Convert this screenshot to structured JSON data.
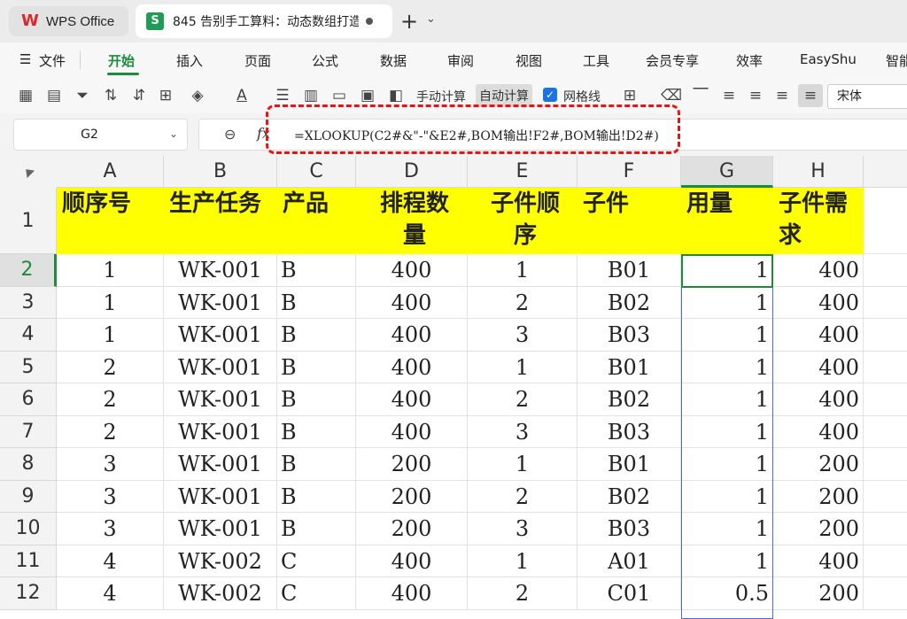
{
  "titlebar": {
    "app_tab": "WPS Office",
    "doc_tab": "845 告别手工算料：动态数组打造",
    "sheet_icon": "S"
  },
  "menu": {
    "file": "文件",
    "items": [
      "开始",
      "插入",
      "页面",
      "公式",
      "数据",
      "审阅",
      "视图",
      "工具",
      "会员专享",
      "效率",
      "EasyShu",
      "智能"
    ]
  },
  "toolbar": {
    "manual_calc": "手动计算",
    "auto_calc": "自动计算",
    "gridlines": "网格线",
    "font": "宋体"
  },
  "formula_bar": {
    "cell_ref": "G2",
    "fx": "fx",
    "formula": "=XLOOKUP(C2#&\"-\"&E2#,BOM输出!F2#,BOM输出!D2#)"
  },
  "sheet": {
    "columns": [
      "A",
      "B",
      "C",
      "D",
      "E",
      "F",
      "G",
      "H"
    ],
    "row_numbers": [
      "1",
      "2",
      "3",
      "4",
      "5",
      "6",
      "7",
      "8",
      "9",
      "10",
      "11",
      "12"
    ],
    "headers": [
      [
        "顺序号"
      ],
      [
        "生产任务"
      ],
      [
        "产品"
      ],
      [
        "排程数",
        "量"
      ],
      [
        "子件顺",
        "序"
      ],
      [
        "子件"
      ],
      [
        "用量"
      ],
      [
        "子件需",
        "求"
      ]
    ],
    "rows": [
      [
        "1",
        "WK-001",
        "B",
        "400",
        "1",
        "B01",
        "1",
        "400"
      ],
      [
        "1",
        "WK-001",
        "B",
        "400",
        "2",
        "B02",
        "1",
        "400"
      ],
      [
        "1",
        "WK-001",
        "B",
        "400",
        "3",
        "B03",
        "1",
        "400"
      ],
      [
        "2",
        "WK-001",
        "B",
        "400",
        "1",
        "B01",
        "1",
        "400"
      ],
      [
        "2",
        "WK-001",
        "B",
        "400",
        "2",
        "B02",
        "1",
        "400"
      ],
      [
        "2",
        "WK-001",
        "B",
        "400",
        "3",
        "B03",
        "1",
        "400"
      ],
      [
        "3",
        "WK-001",
        "B",
        "200",
        "1",
        "B01",
        "1",
        "200"
      ],
      [
        "3",
        "WK-001",
        "B",
        "200",
        "2",
        "B02",
        "1",
        "200"
      ],
      [
        "3",
        "WK-001",
        "B",
        "200",
        "3",
        "B03",
        "1",
        "200"
      ],
      [
        "4",
        "WK-002",
        "C",
        "400",
        "1",
        "A01",
        "1",
        "400"
      ],
      [
        "4",
        "WK-002",
        "C",
        "400",
        "2",
        "C01",
        "0.5",
        "200"
      ]
    ]
  },
  "colors": {
    "header_fill": "#ffff00",
    "accent": "#1a8c3a",
    "highlight": "#e11111"
  }
}
